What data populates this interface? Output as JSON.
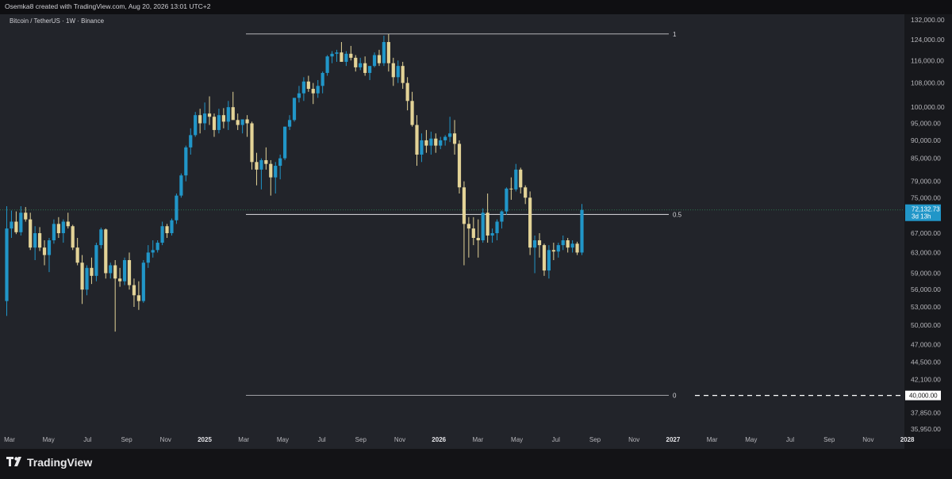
{
  "header": {
    "caption": "Osemka8 created with TradingView.com, Aug 20, 2026 13:01 UTC+2"
  },
  "symbol": {
    "label": "Bitcoin / TetherUS · 1W · Binance"
  },
  "footer": {
    "brand": "TradingView"
  },
  "colors": {
    "up": "#2196c8",
    "down": "#e3d397",
    "background": "#22242a",
    "line": "#c8c8cc",
    "dashed": "#ffffff"
  },
  "chart_data": {
    "type": "candlestick",
    "y_scale": "log",
    "ylim": [
      35950,
      132000
    ],
    "price_ticks": [
      "132,000.00",
      "124,000.00",
      "116,000.00",
      "108,000.00",
      "100,000.00",
      "95,000.00",
      "90,000.00",
      "85,000.00",
      "79,000.00",
      "75,000.00",
      "67,000.00",
      "63,000.00",
      "59,000.00",
      "56,000.00",
      "53,000.00",
      "50,000.00",
      "47,000.00",
      "44,500.00",
      "42,100.00",
      "37,850.00",
      "35,950.00"
    ],
    "x_ticks": [
      "Mar",
      "May",
      "Jul",
      "Sep",
      "Nov",
      "2025",
      "Mar",
      "May",
      "Jul",
      "Sep",
      "Nov",
      "2026",
      "Mar",
      "May",
      "Jul",
      "Sep",
      "Nov",
      "2027",
      "Mar",
      "May",
      "Jul",
      "Sep",
      "Nov",
      "2028"
    ],
    "last_price": {
      "label": "72,132.73",
      "countdown": "3d 13h",
      "value": 72132.73
    },
    "horizontal_level": {
      "label": "40,000.00",
      "value": 40000,
      "style": "dashed"
    },
    "fib_levels": [
      {
        "label": "1",
        "value": 126200
      },
      {
        "label": "0.5",
        "value": 71100
      },
      {
        "label": "0",
        "value": 40000
      }
    ],
    "candles": [
      [
        54000,
        73000,
        51500,
        68000
      ],
      [
        68000,
        72000,
        66000,
        69500
      ],
      [
        69500,
        71800,
        66800,
        67200
      ],
      [
        67200,
        73000,
        66500,
        71500
      ],
      [
        71500,
        72800,
        69500,
        70000
      ],
      [
        70000,
        71500,
        63500,
        64000
      ],
      [
        64000,
        68500,
        61500,
        67000
      ],
      [
        67000,
        68300,
        63300,
        64000
      ],
      [
        64000,
        65500,
        60500,
        62500
      ],
      [
        62500,
        66000,
        59200,
        65500
      ],
      [
        65500,
        70000,
        64800,
        69000
      ],
      [
        69000,
        70500,
        66000,
        67000
      ],
      [
        67000,
        70000,
        65000,
        69500
      ],
      [
        69500,
        71500,
        68000,
        68500
      ],
      [
        68500,
        68800,
        63500,
        64000
      ],
      [
        64000,
        66000,
        60500,
        61000
      ],
      [
        61000,
        62500,
        53500,
        56000
      ],
      [
        56000,
        60500,
        55000,
        60000
      ],
      [
        60000,
        62000,
        57000,
        58500
      ],
      [
        58500,
        65000,
        57500,
        64500
      ],
      [
        64500,
        68200,
        63800,
        67800
      ],
      [
        67800,
        68000,
        58000,
        59000
      ],
      [
        59000,
        61000,
        58000,
        60500
      ],
      [
        60500,
        61500,
        49000,
        58000
      ],
      [
        58000,
        60000,
        56500,
        57500
      ],
      [
        57500,
        62000,
        56800,
        61500
      ],
      [
        61500,
        63000,
        56000,
        56800
      ],
      [
        56800,
        58000,
        53000,
        55000
      ],
      [
        55000,
        57500,
        52500,
        54000
      ],
      [
        54000,
        61500,
        53700,
        61000
      ],
      [
        61000,
        64500,
        60000,
        63000
      ],
      [
        63000,
        65500,
        62000,
        63500
      ],
      [
        63500,
        65500,
        63000,
        65000
      ],
      [
        65000,
        69500,
        64500,
        68500
      ],
      [
        68500,
        69000,
        66000,
        67000
      ],
      [
        67000,
        70200,
        66500,
        69800
      ],
      [
        69800,
        76000,
        69000,
        75500
      ],
      [
        75500,
        81000,
        75000,
        80500
      ],
      [
        80500,
        88500,
        79000,
        88000
      ],
      [
        88000,
        93500,
        86000,
        91500
      ],
      [
        91500,
        98500,
        91000,
        97500
      ],
      [
        97500,
        99500,
        92000,
        95000
      ],
      [
        95000,
        101500,
        93000,
        98000
      ],
      [
        98000,
        103500,
        94500,
        97000
      ],
      [
        97000,
        98000,
        91000,
        93000
      ],
      [
        93000,
        99500,
        92000,
        97500
      ],
      [
        97500,
        99700,
        93500,
        95500
      ],
      [
        95500,
        102000,
        93000,
        100000
      ],
      [
        100000,
        105000,
        97000,
        96000
      ],
      [
        96000,
        98000,
        93000,
        94500
      ],
      [
        94500,
        96000,
        92000,
        96200
      ],
      [
        96200,
        97500,
        91000,
        95000
      ],
      [
        95000,
        95500,
        82000,
        84000
      ],
      [
        84000,
        86500,
        78000,
        82000
      ],
      [
        82000,
        85000,
        77000,
        84500
      ],
      [
        84500,
        88000,
        82000,
        83500
      ],
      [
        83500,
        84500,
        75500,
        80000
      ],
      [
        80000,
        84000,
        76000,
        83000
      ],
      [
        83000,
        86000,
        79500,
        85000
      ],
      [
        85000,
        94000,
        84500,
        94000
      ],
      [
        94000,
        97500,
        93000,
        96000
      ],
      [
        96000,
        103000,
        95500,
        103000
      ],
      [
        103000,
        107000,
        101500,
        104500
      ],
      [
        104500,
        110000,
        102000,
        108500
      ],
      [
        108500,
        110500,
        105000,
        106000
      ],
      [
        106000,
        108000,
        101000,
        104500
      ],
      [
        104500,
        109000,
        103000,
        107000
      ],
      [
        107000,
        112000,
        104500,
        111500
      ],
      [
        111500,
        118000,
        110500,
        117500
      ],
      [
        117500,
        119500,
        115000,
        118500
      ],
      [
        118500,
        120000,
        115500,
        119000
      ],
      [
        119000,
        123000,
        117000,
        115500
      ],
      [
        115500,
        119500,
        114000,
        118500
      ],
      [
        118500,
        121500,
        116000,
        117000
      ],
      [
        117000,
        118000,
        112000,
        113500
      ],
      [
        113500,
        117000,
        112500,
        115000
      ],
      [
        115000,
        117500,
        110500,
        111500
      ],
      [
        111500,
        113000,
        109000,
        114000
      ],
      [
        114000,
        119000,
        113500,
        118000
      ],
      [
        118000,
        120000,
        114000,
        115000
      ],
      [
        115000,
        125500,
        114000,
        123000
      ],
      [
        123000,
        126200,
        112000,
        115000
      ],
      [
        115000,
        117000,
        107000,
        110000
      ],
      [
        110000,
        116000,
        108000,
        114000
      ],
      [
        114000,
        115500,
        106000,
        108000
      ],
      [
        108000,
        110000,
        99000,
        102000
      ],
      [
        102000,
        105000,
        94000,
        94500
      ],
      [
        94500,
        97500,
        83000,
        86000
      ],
      [
        86000,
        92000,
        84000,
        90000
      ],
      [
        90000,
        93000,
        86500,
        88500
      ],
      [
        88500,
        92500,
        86000,
        90500
      ],
      [
        90500,
        92000,
        86500,
        88500
      ],
      [
        88500,
        91000,
        87500,
        90000
      ],
      [
        90000,
        91500,
        88500,
        91000
      ],
      [
        91000,
        97000,
        89500,
        92000
      ],
      [
        92000,
        96000,
        86000,
        89000
      ],
      [
        89000,
        90000,
        76000,
        77500
      ],
      [
        77500,
        79000,
        60500,
        69000
      ],
      [
        69000,
        70500,
        62000,
        68000
      ],
      [
        68000,
        70500,
        64500,
        66000
      ],
      [
        66000,
        70000,
        62000,
        65500
      ],
      [
        65500,
        72500,
        65000,
        71500
      ],
      [
        71500,
        76000,
        65000,
        66500
      ],
      [
        66500,
        68000,
        65000,
        67000
      ],
      [
        67000,
        70000,
        65500,
        69500
      ],
      [
        69500,
        72000,
        68000,
        71800
      ],
      [
        71800,
        77500,
        71000,
        77200
      ],
      [
        77200,
        80000,
        74500,
        77000
      ],
      [
        77000,
        83500,
        76500,
        82000
      ],
      [
        82000,
        82500,
        76000,
        77500
      ],
      [
        77500,
        78000,
        73500,
        75000
      ],
      [
        75000,
        76500,
        62500,
        64000
      ],
      [
        64000,
        66500,
        59000,
        65500
      ],
      [
        65500,
        67000,
        62000,
        64500
      ],
      [
        64500,
        64800,
        58500,
        59500
      ],
      [
        59500,
        64500,
        58000,
        63500
      ],
      [
        63500,
        65000,
        61500,
        63200
      ],
      [
        63200,
        65000,
        62000,
        64500
      ],
      [
        64500,
        66500,
        63500,
        65500
      ],
      [
        65500,
        66000,
        63000,
        64000
      ],
      [
        64000,
        65500,
        63000,
        64800
      ],
      [
        64800,
        65200,
        62500,
        63000
      ],
      [
        63000,
        73500,
        62500,
        72132.73
      ]
    ]
  }
}
